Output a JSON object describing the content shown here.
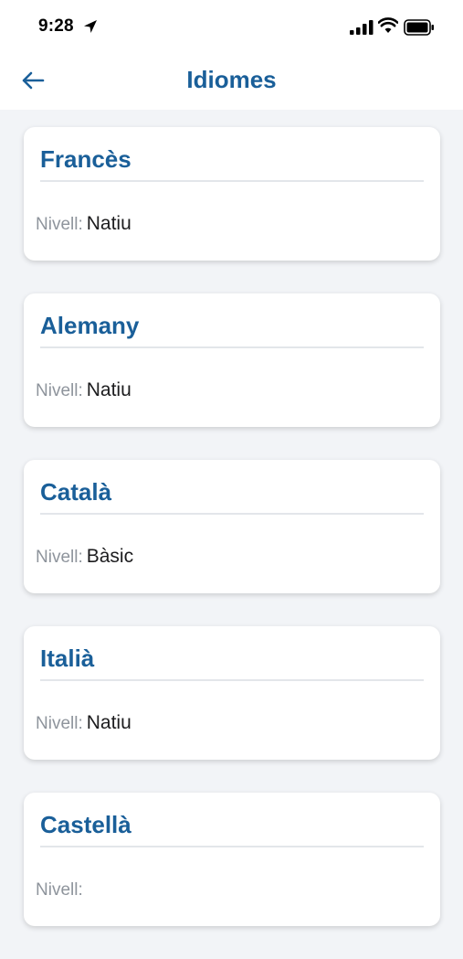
{
  "status_bar": {
    "time": "9:28",
    "icons": [
      "location-arrow-icon",
      "cellular-signal-icon",
      "wifi-icon",
      "battery-icon"
    ]
  },
  "header": {
    "title": "Idiomes",
    "back_icon": "arrow-left-icon"
  },
  "colors": {
    "accent": "#1a5f99",
    "background": "#f2f4f7",
    "label_gray": "#8e949c"
  },
  "languages": [
    {
      "name": "Francès",
      "level_label": "Nivell:",
      "level": "Natiu"
    },
    {
      "name": "Alemany",
      "level_label": "Nivell:",
      "level": "Natiu"
    },
    {
      "name": "Català",
      "level_label": "Nivell:",
      "level": "Bàsic"
    },
    {
      "name": "Italià",
      "level_label": "Nivell:",
      "level": "Natiu"
    },
    {
      "name": "Castellà",
      "level_label": "Nivell:",
      "level": ""
    }
  ]
}
